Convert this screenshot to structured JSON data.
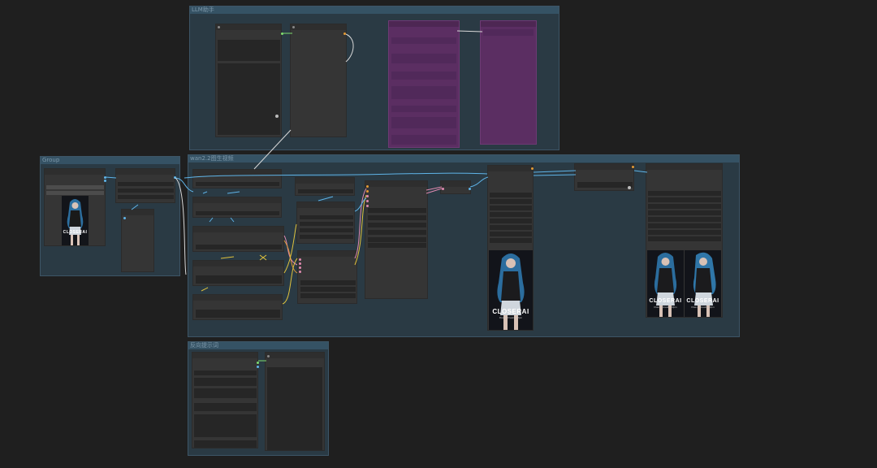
{
  "canvas": {
    "background": "#1f1f1f"
  },
  "groups": {
    "llm": {
      "title": "LLM助手"
    },
    "wan": {
      "title": "wan2.2图生视频"
    },
    "group": {
      "title": "Group"
    },
    "reverse": {
      "title": "反向提示词"
    }
  },
  "thumbnails": {
    "brand": "CLOSERAI",
    "brand_sub": "Flow & Creative Rpm"
  },
  "colors": {
    "group_bg": "#2a3a44",
    "group_header": "#355264",
    "node_bg": "#353535",
    "purple_node": "#5b2e62",
    "wire_blue": "#5fb4e8",
    "wire_yellow": "#e0c23c",
    "wire_pink": "#e08ab0",
    "wire_white": "#d8d8d8",
    "wire_green": "#7fdc6e",
    "wire_orange": "#e39a35"
  },
  "icons": [
    "node-collapse-dot-icon",
    "input-slot-icon",
    "output-slot-icon"
  ]
}
